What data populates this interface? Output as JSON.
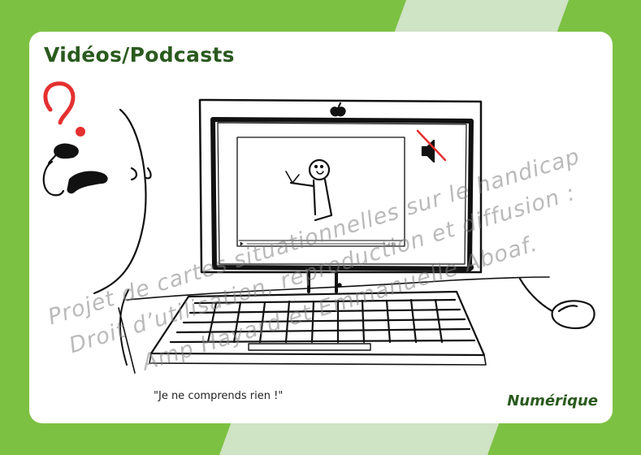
{
  "card": {
    "title": "Vidéos/Podcasts",
    "caption": "\"Je ne comprends rien !\"",
    "category": "Numérique"
  },
  "watermark": {
    "line1": "Projet de cartes situationnelles sur le handicap",
    "line2": "Droit d’utilisation, reproduction et diffusion :",
    "line3": "Amp Hayard et Emmanuelle Aboaf."
  },
  "colors": {
    "background_green": "#7dc143",
    "title_green": "#2a5a1e",
    "accent_red": "#e53030"
  },
  "icons": [
    "question-mark-icon",
    "hearing-aid-icon",
    "mute-speaker-icon",
    "apple-logo-icon"
  ]
}
